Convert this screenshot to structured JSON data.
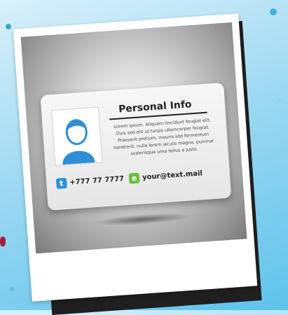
{
  "card": {
    "title": "Personal Info",
    "body": "Lorem ipsum. Aliquam tincidunt feugiat elit. Duis sed elit ut turpis ullamcorper feugiat. Praesent pretium, mauris sed fermentum hendrerit, nulla lorem iaculis magna, pulvinar scelerisque urna tellus a justo.",
    "phone": {
      "icon": "t",
      "text": "+777 77 7777"
    },
    "email": {
      "icon": "e",
      "text": "your@text.mail"
    }
  },
  "colors": {
    "background": "#5ec3eb",
    "avatar": "#2e8fd6",
    "phone_badge": "#2e8fd6",
    "email_badge": "#6abf3c"
  },
  "icons": [
    "person-avatar-icon",
    "tumblr-icon",
    "email-icon"
  ]
}
